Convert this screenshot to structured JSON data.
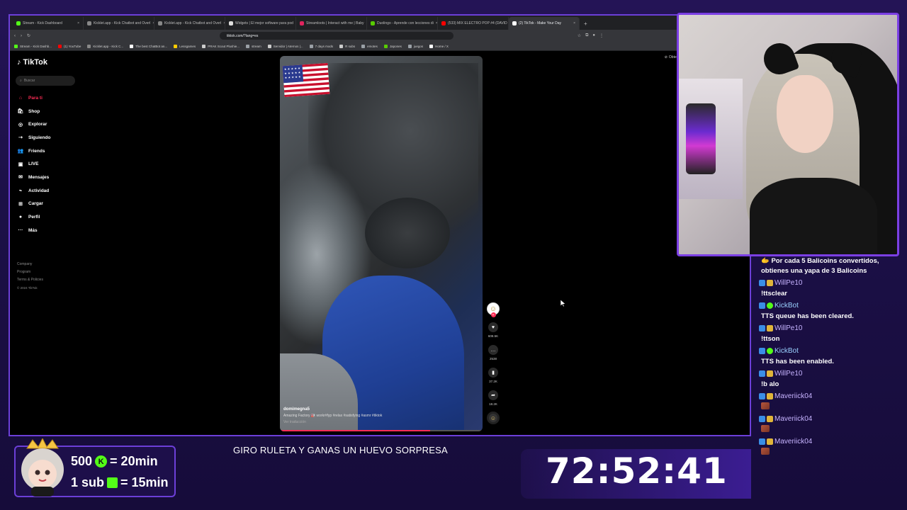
{
  "browser": {
    "tabs": [
      {
        "label": "Stream - Kick Dashboard",
        "color": "#53fc18"
      },
      {
        "label": "Kicklet.app - Kick Chatbot and Overl",
        "color": "#888888"
      },
      {
        "label": "Kicklet.app - Kick Chatbot and Overl",
        "color": "#888888"
      },
      {
        "label": "Widgets | El mejor software para pod",
        "color": "#dddddd"
      },
      {
        "label": "Streamloots | Interact with me | Baby",
        "color": "#e0245e"
      },
      {
        "label": "Duolingo - Aprende con lecciones di",
        "color": "#58cc02"
      },
      {
        "label": "(533) MIX ELECTRO POP #4 (DAVID C",
        "color": "#ff0000"
      },
      {
        "label": "(2) TikTok - Make Your Day",
        "color": "#ffffff",
        "active": true
      }
    ],
    "url": "tiktok.com/?lang=es",
    "bookmarks": [
      {
        "label": "Stream - Kick Dashb...",
        "color": "#53fc18"
      },
      {
        "label": "(1) YouTube",
        "color": "#ff0000"
      },
      {
        "label": "Kicklet.app - Kick C...",
        "color": "#888888"
      },
      {
        "label": "The best ChatBot an...",
        "color": "#ffffff"
      },
      {
        "label": "Lessgames",
        "color": "#ffcc00"
      },
      {
        "label": "PRAK Scout Plushie...",
        "color": "#cccccc"
      },
      {
        "label": "stream",
        "color": "#9aa0a6"
      },
      {
        "label": "Servidor | Aternos |...",
        "color": "#cccccc"
      },
      {
        "label": "7 days mods",
        "color": "#9aa0a6"
      },
      {
        "label": "R subs",
        "color": "#cccccc"
      },
      {
        "label": "emotes",
        "color": "#9aa0a6"
      },
      {
        "label": "Japones",
        "color": "#58cc02"
      },
      {
        "label": "juegos",
        "color": "#9aa0a6"
      },
      {
        "label": "Home / X",
        "color": "#ffffff"
      }
    ]
  },
  "tiktok": {
    "logo": "TikTok",
    "search_placeholder": "Buscar",
    "nav": [
      {
        "label": "Para ti",
        "icon": "home-icon",
        "glyph": "⌂",
        "active": true
      },
      {
        "label": "Shop",
        "icon": "shop-icon",
        "glyph": "🛍"
      },
      {
        "label": "Explorar",
        "icon": "compass-icon",
        "glyph": "◎"
      },
      {
        "label": "Siguiendo",
        "icon": "following-icon",
        "glyph": "⇢"
      },
      {
        "label": "Friends",
        "icon": "friends-icon",
        "glyph": "👥"
      },
      {
        "label": "LIVE",
        "icon": "live-icon",
        "glyph": "▣"
      },
      {
        "label": "Mensajes",
        "icon": "messages-icon",
        "glyph": "✉"
      },
      {
        "label": "Actividad",
        "icon": "activity-icon",
        "glyph": "⌁"
      },
      {
        "label": "Cargar",
        "icon": "upload-icon",
        "glyph": "⊞"
      },
      {
        "label": "Perfil",
        "icon": "profile-icon",
        "glyph": "●"
      },
      {
        "label": "Más",
        "icon": "more-icon",
        "glyph": "···"
      }
    ],
    "footer": {
      "company": "Company",
      "program": "Program",
      "terms": "Terms & Policies",
      "copyright": "© 2024 TikTok"
    },
    "get_app": "Obtener",
    "video": {
      "username": "domimegna5",
      "caption": "Amazing Factory 🏭 workr#fyp #relax #satisfying #asmr #tiktok",
      "translate": "Ver traducción",
      "progress": 0.74,
      "likes": "608.5K",
      "comments": "2538",
      "saves": "37.2K",
      "shares": "18.2K"
    }
  },
  "chat": {
    "messages": [
      {
        "type": "text",
        "text": "🫱 Por cada 5 Balicoins convertidos, obtienes una yapa de 3 Balicoins"
      },
      {
        "type": "user",
        "name": "WillPe10"
      },
      {
        "type": "text",
        "text": "!ttsclear"
      },
      {
        "type": "user",
        "name": "KickBot",
        "kick": true
      },
      {
        "type": "text",
        "text": "TTS queue has been cleared."
      },
      {
        "type": "user",
        "name": "WillPe10"
      },
      {
        "type": "text",
        "text": "!ttson"
      },
      {
        "type": "user",
        "name": "KickBot",
        "kick": true
      },
      {
        "type": "text",
        "text": "TTS has been enabled."
      },
      {
        "type": "user",
        "name": "WillPe10"
      },
      {
        "type": "text",
        "text": "!b alo"
      },
      {
        "type": "user",
        "name": "Maveriick04"
      },
      {
        "type": "emote"
      },
      {
        "type": "user",
        "name": "Maveriick04"
      },
      {
        "type": "emote"
      },
      {
        "type": "user",
        "name": "Maveriick04"
      },
      {
        "type": "emote"
      }
    ]
  },
  "overlay": {
    "promo_line1_amount": "500",
    "promo_line1_rest": "= 20min",
    "promo_line2_amount": "1 sub",
    "promo_line2_rest": "= 15min",
    "marquee": "GIRO RULETA Y GANAS UN HUEVO SORPRESA",
    "timer": "72:52:41",
    "accent": "#6c3fd8",
    "kick_green": "#53fc18"
  }
}
